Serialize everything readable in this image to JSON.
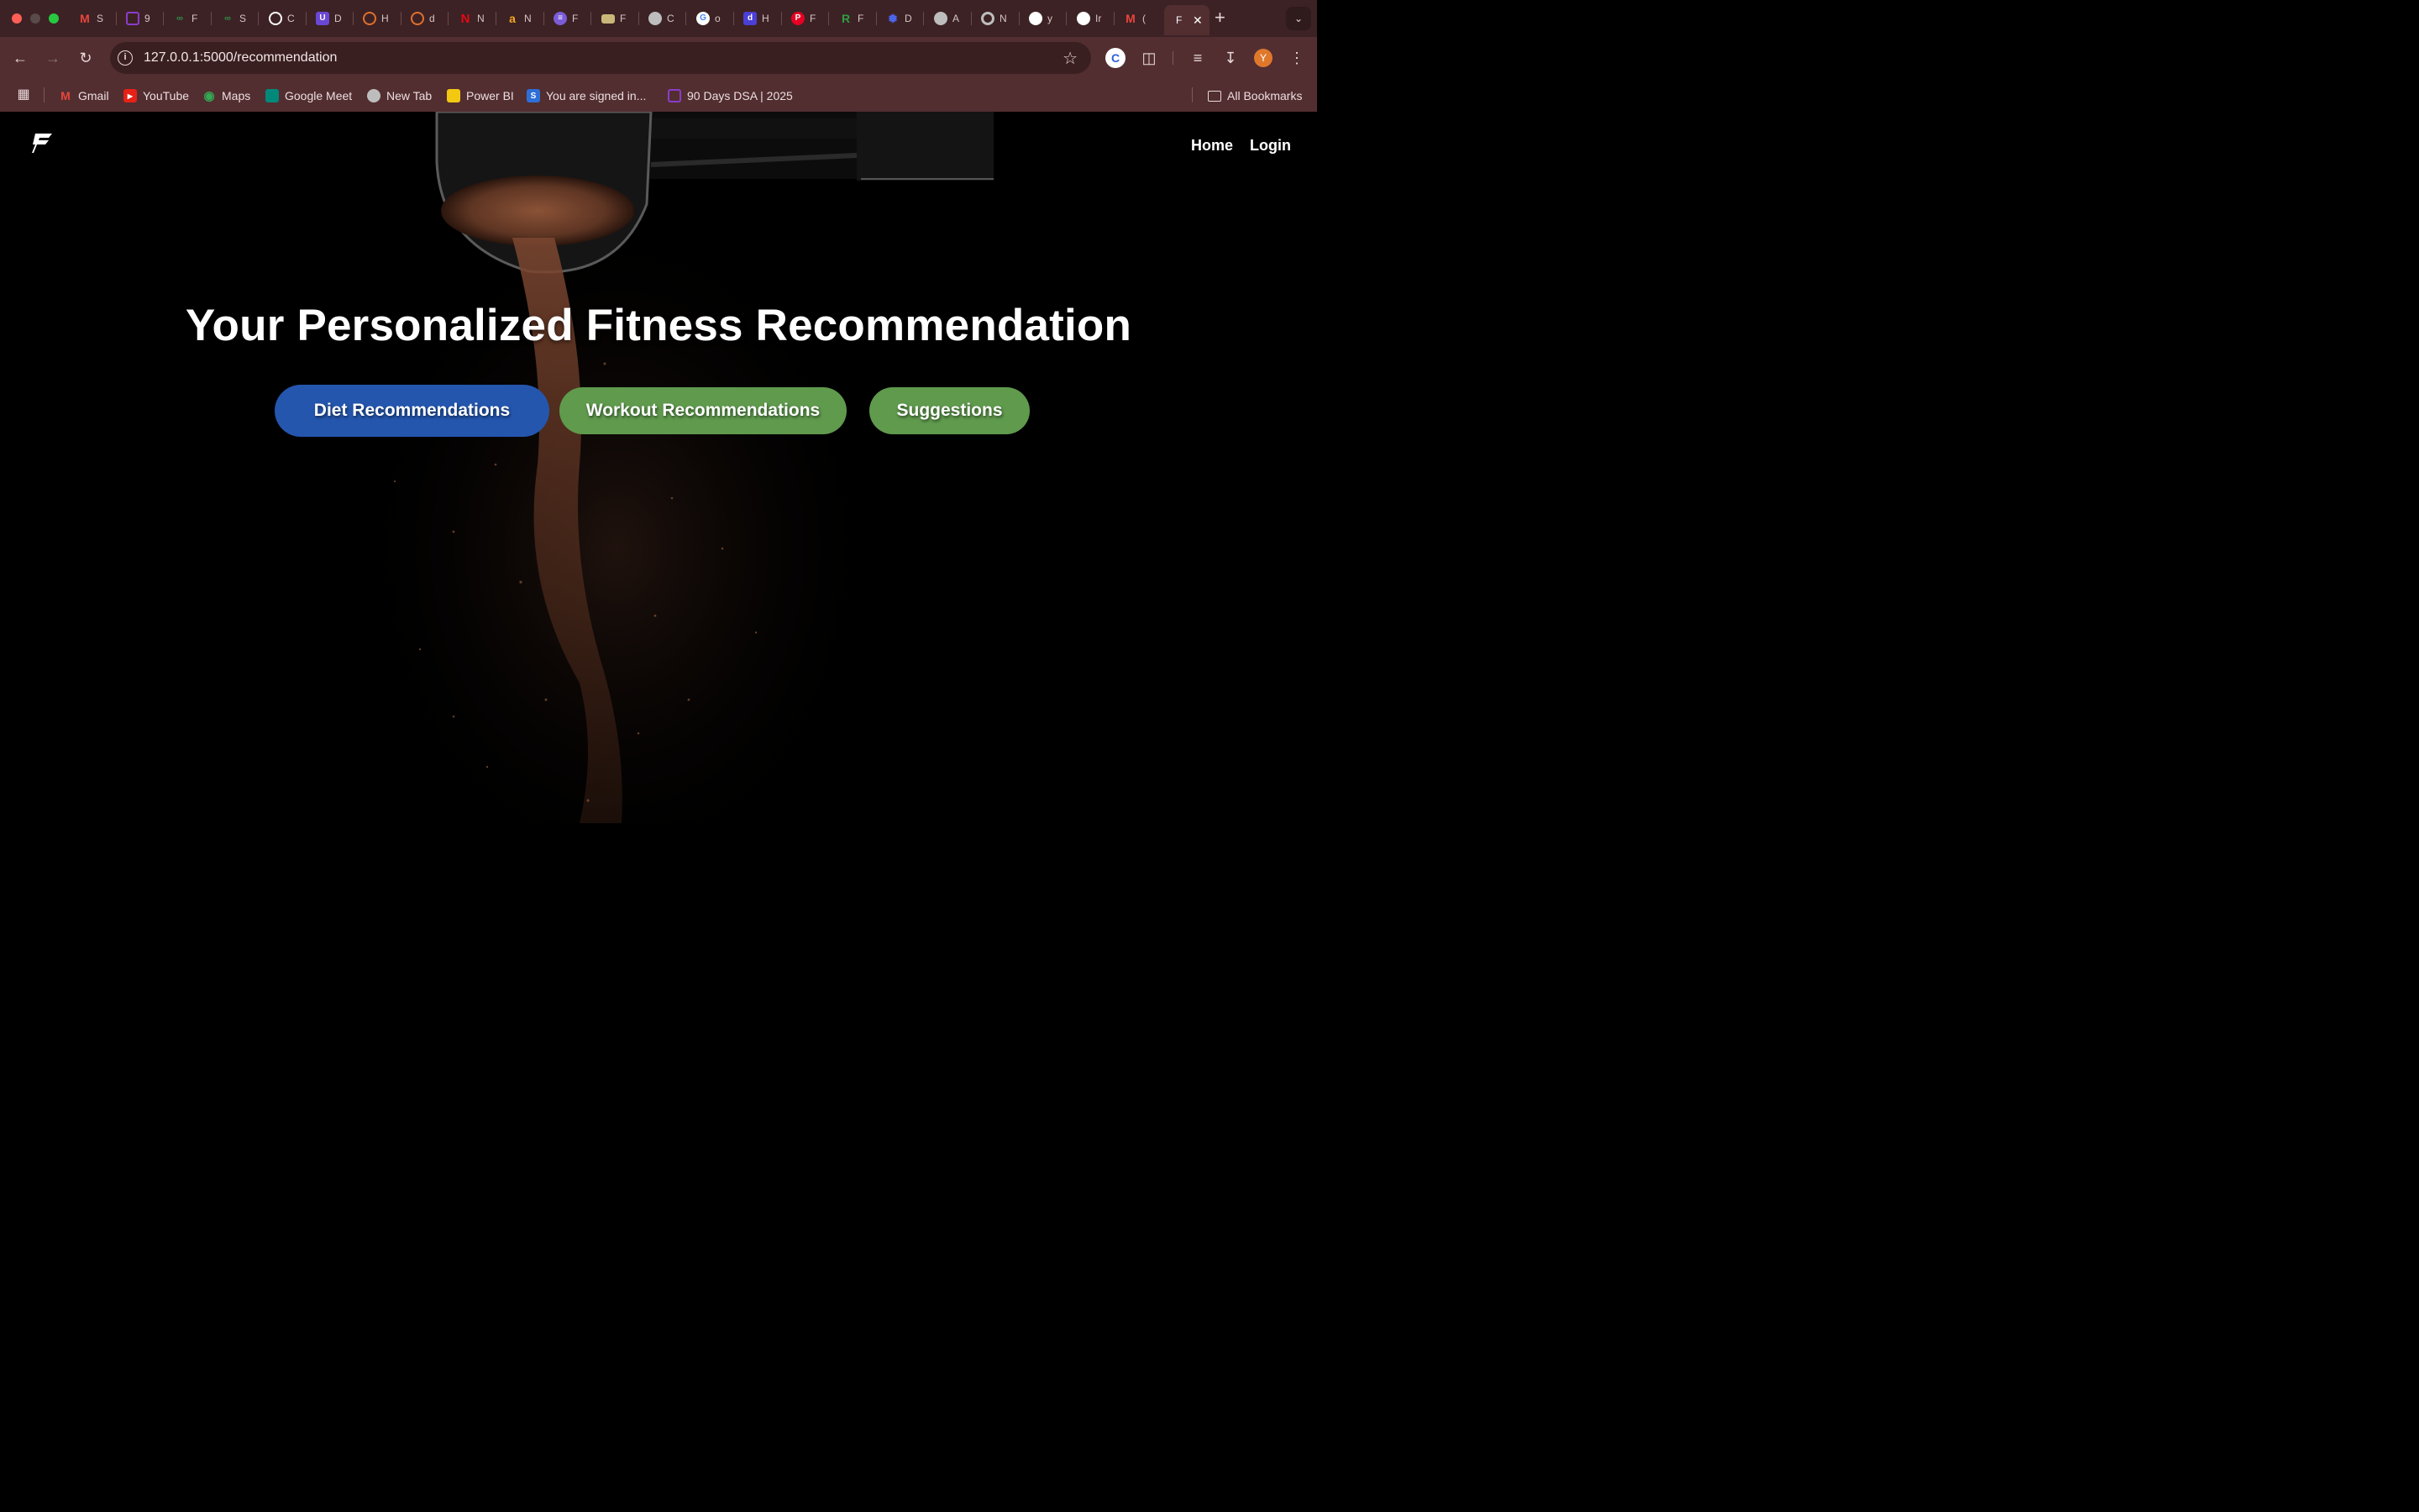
{
  "browser": {
    "tabs": [
      {
        "label": "S",
        "icon": "gmail-icon",
        "color": "#e8453c"
      },
      {
        "label": "9",
        "icon": "monitor-icon",
        "color": "#8b3cc9"
      },
      {
        "label": "F",
        "icon": "geeks-icon",
        "color": "#2f8d46"
      },
      {
        "label": "S",
        "icon": "geeks-icon",
        "color": "#2f8d46"
      },
      {
        "label": "C",
        "icon": "openai-icon",
        "color": "#ffffff"
      },
      {
        "label": "D",
        "icon": "shield-icon",
        "color": "#6b47d6"
      },
      {
        "label": "H",
        "icon": "ring-icon",
        "color": "#e0702c"
      },
      {
        "label": "d",
        "icon": "doc-icon",
        "color": "#e0702c"
      },
      {
        "label": "N",
        "icon": "netflix-icon",
        "color": "#e50914"
      },
      {
        "label": "N",
        "icon": "amazon-icon",
        "color": "#f5a623"
      },
      {
        "label": "F",
        "icon": "list-icon",
        "color": "#7b5cd6"
      },
      {
        "label": "F",
        "icon": "mail-icon",
        "color": "#c9b77a"
      },
      {
        "label": "C",
        "icon": "globe-icon",
        "color": "#cfcfcf"
      },
      {
        "label": "o",
        "icon": "google-icon",
        "color": "#ffffff"
      },
      {
        "label": "H",
        "icon": "d-icon",
        "color": "#4b3fd6"
      },
      {
        "label": "F",
        "icon": "pinterest-icon",
        "color": "#e60023"
      },
      {
        "label": "F",
        "icon": "r-icon",
        "color": "#2f9e44"
      },
      {
        "label": "D",
        "icon": "deepseek-icon",
        "color": "#4d6bfe"
      },
      {
        "label": "A",
        "icon": "globe-icon",
        "color": "#cfcfcf"
      },
      {
        "label": "N",
        "icon": "chrome-icon",
        "color": "#cfcfcf"
      },
      {
        "label": "y",
        "icon": "github-icon",
        "color": "#ffffff"
      },
      {
        "label": "Ir",
        "icon": "github-icon",
        "color": "#ffffff"
      },
      {
        "label": "(",
        "icon": "gmail-icon",
        "color": "#e8453c"
      }
    ],
    "active_tab": {
      "label": "F",
      "close": "✕"
    },
    "new_tab": "+",
    "tab_search": "⌄",
    "url": "127.0.0.1:5000/recommendation",
    "avatar_letter": "Y"
  },
  "bookmarks": [
    {
      "label": "Gmail",
      "icon": "gmail-icon"
    },
    {
      "label": "YouTube",
      "icon": "youtube-icon"
    },
    {
      "label": "Maps",
      "icon": "maps-icon"
    },
    {
      "label": "Google Meet",
      "icon": "meet-icon"
    },
    {
      "label": "New Tab",
      "icon": "globe-icon"
    },
    {
      "label": "Power BI",
      "icon": "powerbi-icon"
    },
    {
      "label": "You are signed in...",
      "icon": "s-icon"
    },
    {
      "label": "90 Days DSA | 2025",
      "icon": "monitor-icon"
    }
  ],
  "all_bookmarks": "All Bookmarks",
  "site": {
    "nav": {
      "home": "Home",
      "login": "Login"
    },
    "title": "Your Personalized Fitness Recommendation",
    "buttons": {
      "diet": "Diet Recommendations",
      "workout": "Workout Recommendations",
      "suggestions": "Suggestions"
    },
    "colors": {
      "diet": "#2456ae",
      "workout": "#5f9a4d",
      "suggestions": "#5f9a4d"
    }
  }
}
